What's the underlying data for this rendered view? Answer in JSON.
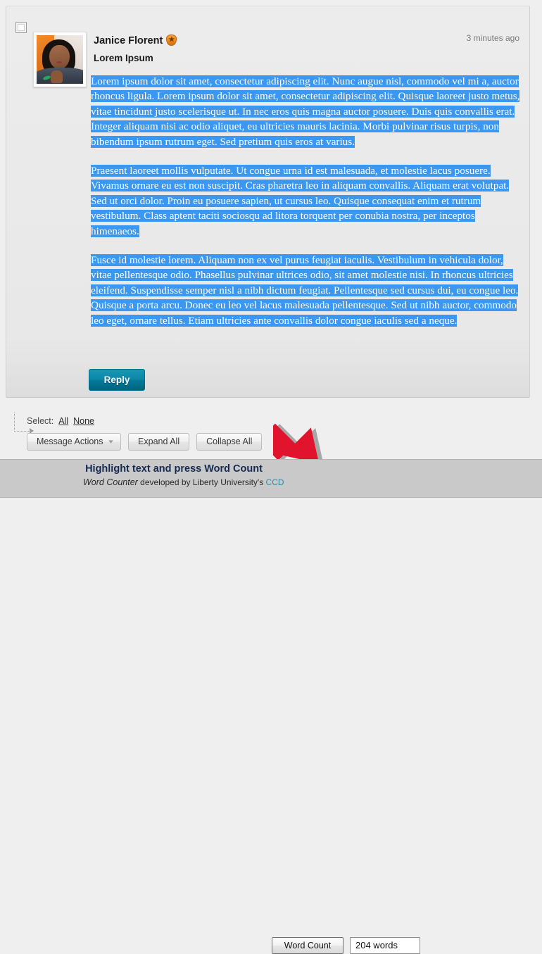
{
  "message": {
    "author": "Janice Florent",
    "author_badge_icon": "star-shield-badge-icon",
    "subject": "Lorem Ipsum",
    "timestamp": "3 minutes ago",
    "avatar_alt": "avatar",
    "checkbox_checked": false,
    "selected_text_color": "#3b97ef",
    "paragraphs": [
      "Lorem ipsum dolor sit amet, consectetur adipiscing elit. Nunc augue nisl, commodo vel mi a, auctor rhoncus ligula. Lorem ipsum dolor sit amet, consectetur adipiscing elit. Quisque laoreet justo metus, vitae tincidunt justo scelerisque ut. In nec eros quis magna auctor posuere. Duis quis convallis erat. Integer aliquam nisi ac odio aliquet, eu ultricies mauris lacinia. Morbi pulvinar risus turpis, non bibendum ipsum rutrum eget. Sed pretium quis eros at varius.",
      "Praesent laoreet mollis vulputate. Ut congue urna id est malesuada, et molestie lacus posuere. Vivamus ornare eu est non suscipit. Cras pharetra leo in aliquam convallis. Aliquam erat volutpat. Sed ut orci dolor. Proin eu posuere sapien, ut cursus leo. Quisque consequat enim et rutrum vestibulum. Class aptent taciti sociosqu ad litora torquent per conubia nostra, per inceptos himenaeos.",
      "Fusce id molestie lorem. Aliquam non ex vel purus feugiat iaculis. Vestibulum in vehicula dolor, vitae pellentesque odio. Phasellus pulvinar ultrices odio, sit amet molestie nisi. In rhoncus ultricies eleifend. Suspendisse semper nisl a nibh dictum feugiat. Pellentesque sed cursus dui, eu congue leo. Quisque a porta arcu. Donec eu leo vel lacus malesuada pellentesque. Sed ut nibh auctor, commodo leo eget, ornare tellus. Etiam ultricies ante convallis dolor congue iaculis sed a neque."
    ],
    "reply_label": "Reply"
  },
  "actions": {
    "select_label": "Select:",
    "select_all_label": "All",
    "select_none_label": "None",
    "message_actions_label": "Message Actions",
    "message_actions_icon": "chevron-down-icon",
    "expand_all_label": "Expand All",
    "collapse_all_label": "Collapse All"
  },
  "annotation": {
    "arrow_icon": "red-arrow-pointing-down-right-icon",
    "arrow_color": "#e2132c"
  },
  "word_counter": {
    "headline": "Highlight text and press Word Count",
    "brand": "Word Counter",
    "credit_middle": " developed by Liberty University's ",
    "credit_link": "CCD",
    "button_label": "Word Count",
    "count_value": "204 words",
    "headline_color": "#152a52",
    "link_color": "#2e8fa8",
    "bar_color": "#c9c9c9"
  }
}
